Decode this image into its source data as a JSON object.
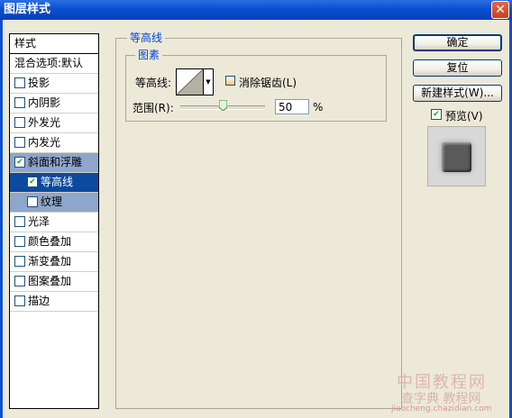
{
  "window": {
    "title": "图层样式",
    "close_glyph": "✕"
  },
  "style_list": {
    "header": "样式",
    "blend_options": "混合选项:默认",
    "items": [
      {
        "label": "投影",
        "checked": false
      },
      {
        "label": "内阴影",
        "checked": false
      },
      {
        "label": "外发光",
        "checked": false
      },
      {
        "label": "内发光",
        "checked": false
      },
      {
        "label": "斜面和浮雕",
        "checked": true
      },
      {
        "label": "等高线",
        "checked": true
      },
      {
        "label": "纹理",
        "checked": false
      },
      {
        "label": "光泽",
        "checked": false
      },
      {
        "label": "颜色叠加",
        "checked": false
      },
      {
        "label": "渐变叠加",
        "checked": false
      },
      {
        "label": "图案叠加",
        "checked": false
      },
      {
        "label": "描边",
        "checked": false
      }
    ],
    "check_glyph": "✔"
  },
  "contour_panel": {
    "group_title": "等高线",
    "elements_title": "图素",
    "contour_label": "等高线:",
    "contour_dropdown_glyph": "▼",
    "anti_alias_label": "消除锯齿(L)",
    "range_label": "范围(R):",
    "range_value": "50",
    "range_unit": "%",
    "range_fraction": 0.5
  },
  "buttons": {
    "ok": "确定",
    "reset": "复位",
    "new_style": "新建样式(W)..."
  },
  "preview": {
    "label": "预览(V)",
    "checked": true
  },
  "watermark": {
    "line1": "中国教程网",
    "line2": "查字典 教程网",
    "line3": "jiaocheng.chazidian.com"
  },
  "colors": {
    "titlebar": "#0a4fcf",
    "group_title": "#0046d5",
    "selected_item": "#0b4a9e",
    "selected_parent": "#8ea6cc"
  }
}
